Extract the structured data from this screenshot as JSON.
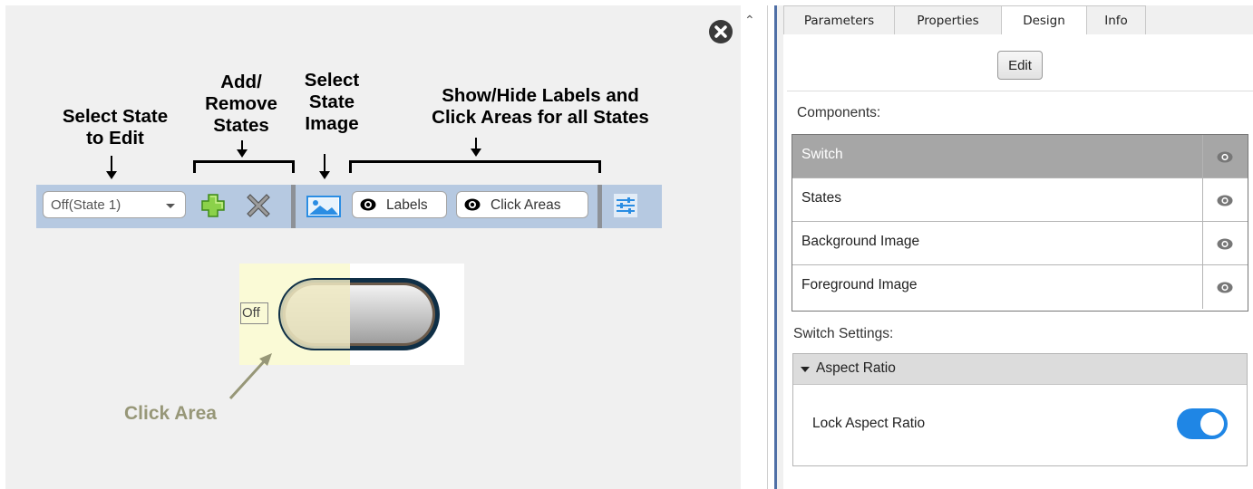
{
  "annotations": {
    "select_state": "Select State\nto Edit",
    "add_remove": "Add/\nRemove\nStates",
    "select_image": "Select\nState\nImage",
    "show_hide": "Show/Hide Labels and\nClick Areas for all States",
    "click_area": "Click Area"
  },
  "toolbar": {
    "state_value": "Off(State 1)",
    "labels_btn": "Labels",
    "click_areas_btn": "Click Areas"
  },
  "preview": {
    "state_label": "Off"
  },
  "tabs": [
    "Parameters",
    "Properties",
    "Design",
    "Info"
  ],
  "active_tab": "Design",
  "panel": {
    "edit_label": "Edit",
    "components_label": "Components:",
    "components": [
      "Switch",
      "States",
      "Background Image",
      "Foreground Image"
    ],
    "selected_component": "Switch",
    "switch_settings_label": "Switch Settings:",
    "aspect_ratio_header": "Aspect Ratio",
    "lock_aspect_label": "Lock Aspect Ratio",
    "lock_aspect_on": true
  },
  "colors": {
    "toolbar_bg": "#b6c9e1",
    "click_area": "#fafad6",
    "click_label": "#979778",
    "toggle_on": "#1f86e5",
    "selected_row": "#a6a6a6",
    "accent_bar": "#4f6fa6"
  },
  "icons": {
    "add": "plus-icon",
    "remove": "x-icon",
    "image": "image-icon",
    "eye": "eye-icon",
    "settings": "sliders-icon",
    "close": "close-circle-icon"
  }
}
